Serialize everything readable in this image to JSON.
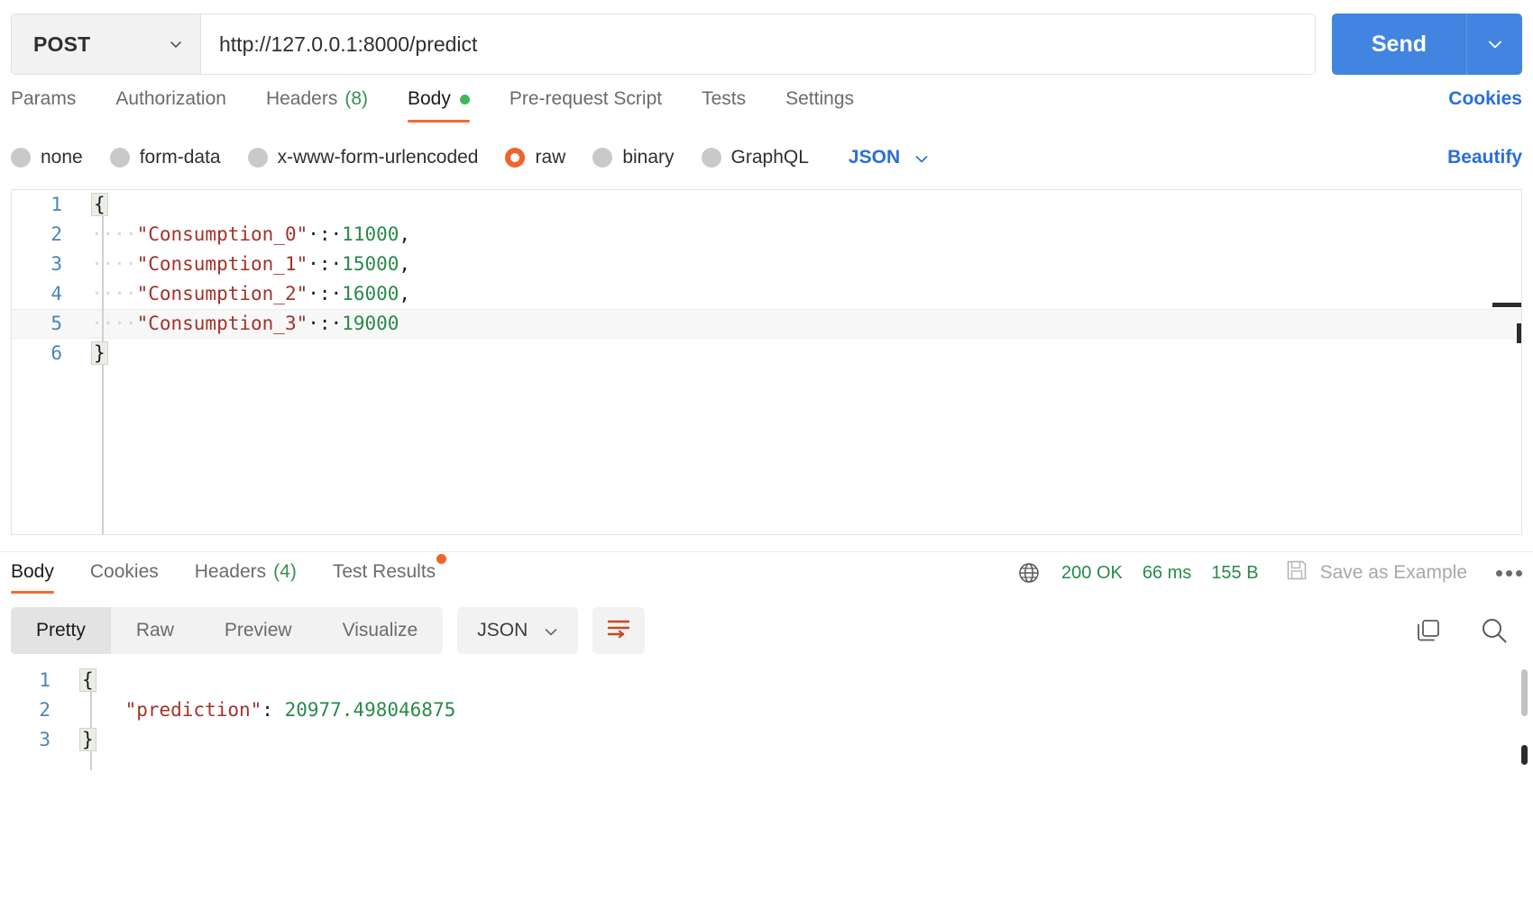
{
  "request": {
    "method": "POST",
    "url": "http://127.0.0.1:8000/predict",
    "send_label": "Send",
    "tabs": [
      {
        "label": "Params",
        "active": false
      },
      {
        "label": "Authorization",
        "active": false
      },
      {
        "label": "Headers",
        "count": "(8)",
        "active": false
      },
      {
        "label": "Body",
        "active": true,
        "dot": "green"
      },
      {
        "label": "Pre-request Script",
        "active": false
      },
      {
        "label": "Tests",
        "active": false
      },
      {
        "label": "Settings",
        "active": false
      }
    ],
    "cookies_link": "Cookies",
    "body_types": [
      {
        "label": "none",
        "selected": false
      },
      {
        "label": "form-data",
        "selected": false
      },
      {
        "label": "x-www-form-urlencoded",
        "selected": false
      },
      {
        "label": "raw",
        "selected": true
      },
      {
        "label": "binary",
        "selected": false
      },
      {
        "label": "GraphQL",
        "selected": false
      }
    ],
    "raw_format": "JSON",
    "beautify_label": "Beautify",
    "editor": {
      "lines": [
        {
          "no": "1",
          "brace": "{",
          "indent": "",
          "key": "",
          "colon": "",
          "value": "",
          "comma": ""
        },
        {
          "no": "2",
          "brace": "",
          "indent": "····",
          "key": "\"Consumption_0\"",
          "colon": "·:·",
          "value": "11000",
          "comma": ","
        },
        {
          "no": "3",
          "brace": "",
          "indent": "····",
          "key": "\"Consumption_1\"",
          "colon": "·:·",
          "value": "15000",
          "comma": ","
        },
        {
          "no": "4",
          "brace": "",
          "indent": "····",
          "key": "\"Consumption_2\"",
          "colon": "·:·",
          "value": "16000",
          "comma": ","
        },
        {
          "no": "5",
          "brace": "",
          "indent": "····",
          "key": "\"Consumption_3\"",
          "colon": "·:·",
          "value": "19000",
          "comma": "",
          "highlight": true
        },
        {
          "no": "6",
          "brace": "}",
          "indent": "",
          "key": "",
          "colon": "",
          "value": "",
          "comma": ""
        }
      ]
    }
  },
  "response": {
    "tabs": [
      {
        "label": "Body",
        "active": true
      },
      {
        "label": "Cookies",
        "active": false
      },
      {
        "label": "Headers",
        "count": "(4)",
        "active": false
      },
      {
        "label": "Test Results",
        "active": false,
        "dot": "orange"
      }
    ],
    "status": "200 OK",
    "time": "66 ms",
    "size": "155 B",
    "save_example_label": "Save as Example",
    "view_modes": [
      {
        "label": "Pretty",
        "active": true
      },
      {
        "label": "Raw",
        "active": false
      },
      {
        "label": "Preview",
        "active": false
      },
      {
        "label": "Visualize",
        "active": false
      }
    ],
    "format": "JSON",
    "body": {
      "lines": [
        {
          "no": "1",
          "brace": "{",
          "indent": "",
          "key": "",
          "colon": "",
          "value": ""
        },
        {
          "no": "2",
          "brace": "",
          "indent": "    ",
          "key": "\"prediction\"",
          "colon": ": ",
          "value": "20977.498046875"
        },
        {
          "no": "3",
          "brace": "}",
          "indent": "",
          "key": "",
          "colon": "",
          "value": ""
        }
      ]
    }
  },
  "colors": {
    "accent_blue": "#4285e0",
    "accent_orange": "#f06a35",
    "status_green": "#2a8a4a",
    "link_blue": "#2a6fd6"
  }
}
